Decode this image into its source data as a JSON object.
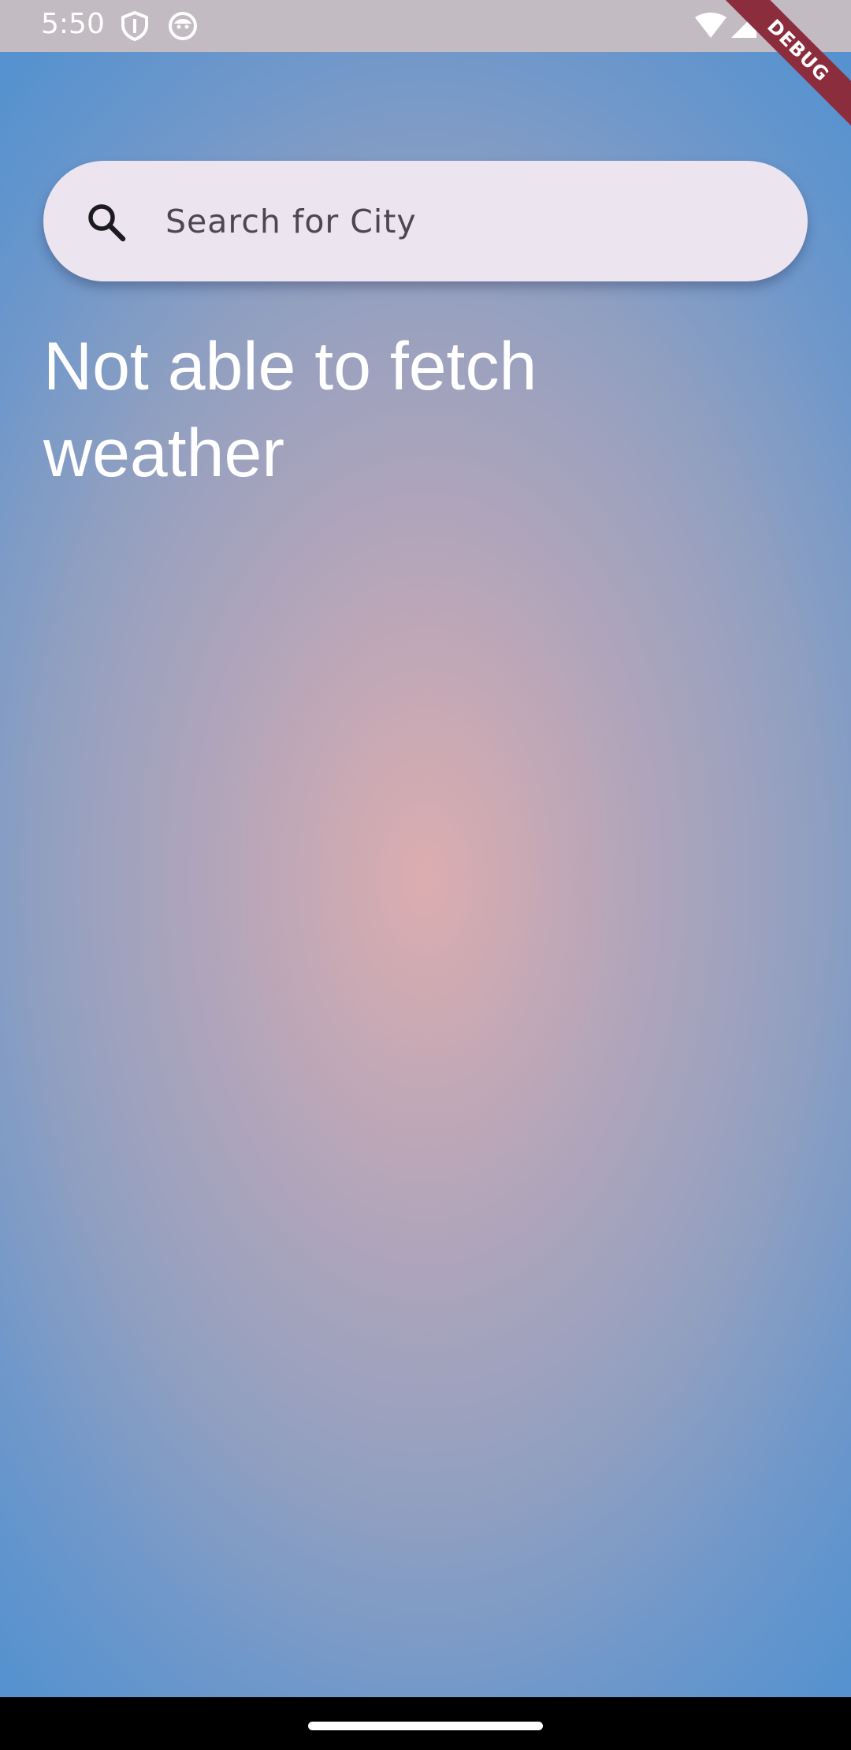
{
  "status_bar": {
    "time": "5:50",
    "icons": [
      "shield-icon",
      "face-icon",
      "wifi-icon",
      "signal-icon"
    ]
  },
  "debug_banner": {
    "label": "DEBUG",
    "color": "#8b2d3c"
  },
  "search": {
    "placeholder": "Search for City",
    "value": "",
    "icon": "search-icon"
  },
  "message": {
    "text": "Not able to fetch weather"
  },
  "colors": {
    "background_center": "#dcadaf",
    "background_edge": "#5592cf",
    "search_bar": "#ece4ee",
    "text": "#ffffff"
  }
}
